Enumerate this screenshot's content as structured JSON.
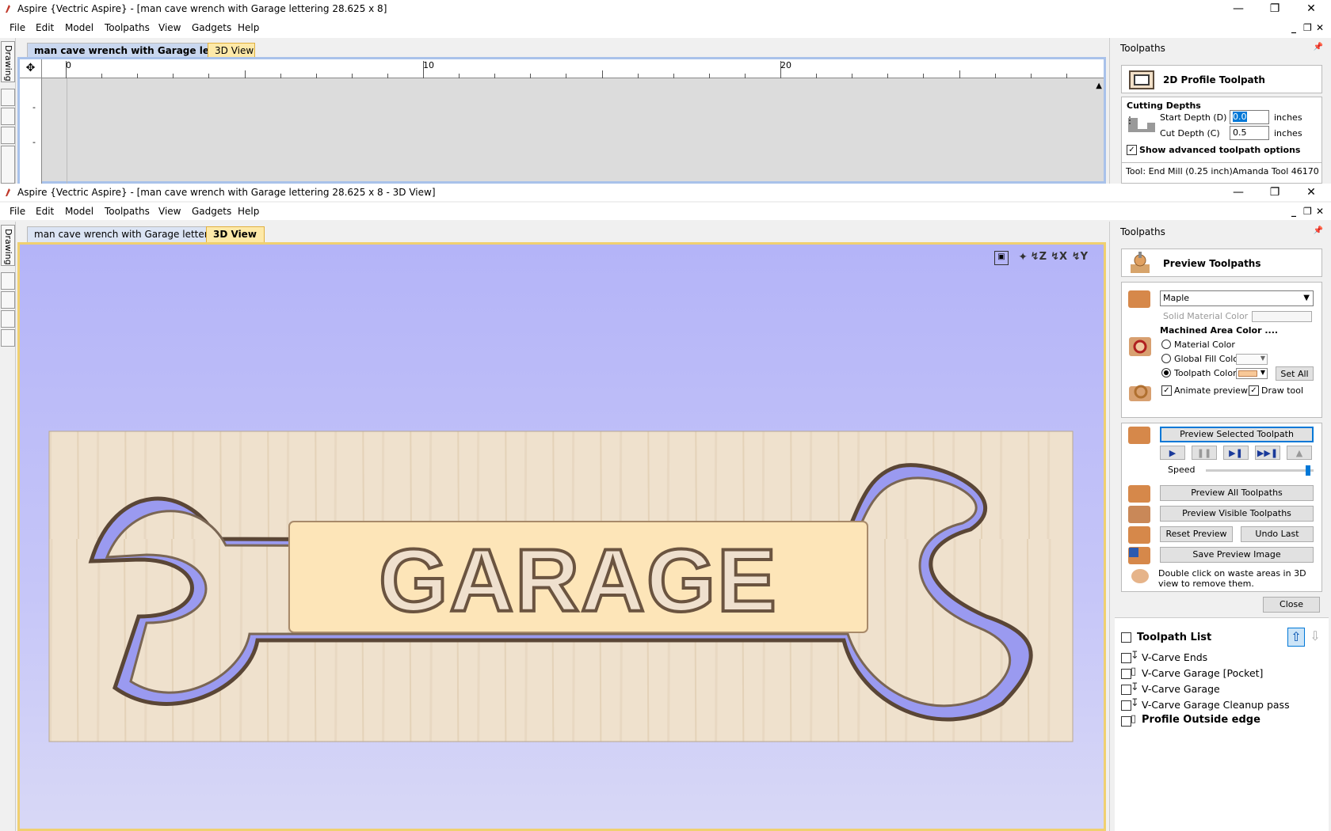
{
  "app": {
    "title_top": "Aspire {Vectric Aspire} - [man cave wrench with Garage lettering 28.625 x 8]",
    "title_bottom": "Aspire {Vectric Aspire} - [man cave wrench with Garage lettering 28.625 x 8 - 3D View]"
  },
  "menu": [
    "File",
    "Edit",
    "Model",
    "Toolpaths",
    "View",
    "Gadgets",
    "Help"
  ],
  "left_strip": {
    "drawing_tab": "Drawing"
  },
  "top_window": {
    "tabs": {
      "doc": "man cave wrench with Garage let...",
      "view3d": "3D View"
    },
    "ruler": {
      "labels": [
        "0",
        "10",
        "20"
      ]
    },
    "panel": {
      "header": "Toolpaths",
      "section_title": "2D Profile Toolpath",
      "cutting_depths": "Cutting Depths",
      "start_depth_label": "Start Depth (D)",
      "start_depth_value": "0.0",
      "cut_depth_label": "Cut Depth (C)",
      "cut_depth_value": "0.5",
      "units1": "inches",
      "units2": "inches",
      "advanced": "Show advanced toolpath options",
      "tool_partial": "Tool: End Mill (0.25 inch)Amanda Tool 46170"
    }
  },
  "bottom_window": {
    "tabs": {
      "doc": "man cave wrench with Garage letter...",
      "view3d": "3D View"
    },
    "viewport": {
      "lettering": "GARAGE",
      "bg_top": "#b4b4f8",
      "bg_bottom": "#d6d6f6",
      "wood": "#efe1cd",
      "pocket": "#fde5b8"
    }
  },
  "preview_panel": {
    "header": "Toolpaths",
    "title": "Preview Toolpaths",
    "material": "Maple",
    "solid_material_color": "Solid Material Color",
    "machined_area": "Machined Area Color ....",
    "radio_material": "Material Color",
    "radio_global": "Global Fill Color",
    "radio_toolpath": "Toolpath Color",
    "set_all": "Set All",
    "animate_preview": "Animate preview",
    "draw_tool": "Draw tool",
    "preview_selected": "Preview Selected Toolpath",
    "speed": "Speed",
    "speed_level": 0.97,
    "preview_all": "Preview All Toolpaths",
    "preview_visible": "Preview Visible Toolpaths",
    "reset_preview": "Reset Preview",
    "undo_last": "Undo Last",
    "save_preview_image": "Save Preview Image",
    "hint": "Double click on waste areas in 3D view to remove them.",
    "close": "Close"
  },
  "toolpath_list": {
    "title": "Toolpath List",
    "items": [
      "V-Carve Ends",
      "V-Carve Garage [Pocket]",
      "V-Carve Garage",
      "V-Carve Garage Cleanup pass",
      "Profile Outside edge"
    ]
  }
}
